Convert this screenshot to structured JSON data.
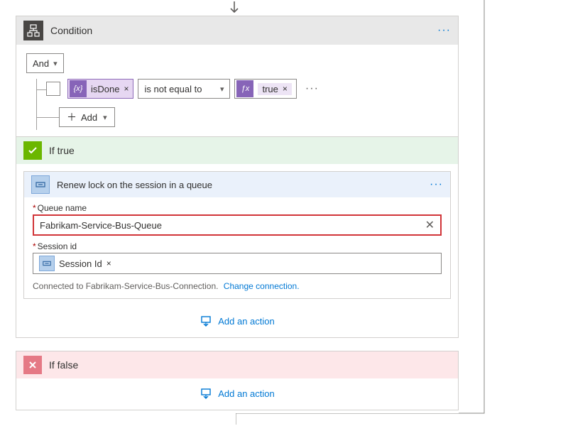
{
  "condition": {
    "title": "Condition",
    "logic": "And",
    "left_token": "isDone",
    "operator": "is not equal to",
    "right_token": "true",
    "add_label": "Add"
  },
  "if_true": {
    "title": "If true",
    "action": {
      "title": "Renew lock on the session in a queue",
      "queue_label": "Queue name",
      "queue_value": "Fabrikam-Service-Bus-Queue",
      "session_label": "Session id",
      "session_token": "Session Id",
      "connection_text": "Connected to Fabrikam-Service-Bus-Connection.",
      "change_link": "Change connection."
    },
    "add_action": "Add an action"
  },
  "if_false": {
    "title": "If false",
    "add_action": "Add an action"
  }
}
